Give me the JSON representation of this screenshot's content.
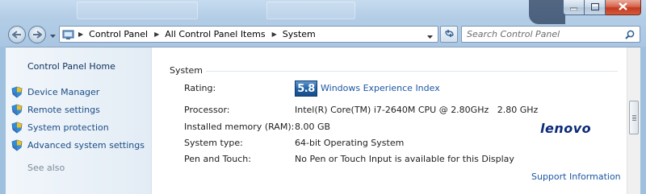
{
  "window": {
    "minimize_icon": "minimize-icon",
    "maximize_icon": "maximize-icon",
    "close_icon": "close-icon"
  },
  "navigation": {
    "back_icon": "back-arrow-icon",
    "forward_icon": "forward-arrow-icon",
    "breadcrumb": [
      "Control Panel",
      "All Control Panel Items",
      "System"
    ],
    "search_placeholder": "Search Control Panel"
  },
  "sidebar": {
    "home_label": "Control Panel Home",
    "tasks": [
      {
        "label": "Device Manager"
      },
      {
        "label": "Remote settings"
      },
      {
        "label": "System protection"
      },
      {
        "label": "Advanced system settings"
      }
    ],
    "see_also_label": "See also"
  },
  "system": {
    "section_title": "System",
    "rows": [
      {
        "label": "Rating:",
        "value": ""
      },
      {
        "label": "Processor:",
        "value": "Intel(R) Core(TM) i7-2640M CPU @ 2.80GHz   2.80 GHz"
      },
      {
        "label": "Installed memory (RAM):",
        "value": "8.00 GB"
      },
      {
        "label": "System type:",
        "value": "64-bit Operating System"
      },
      {
        "label": "Pen and Touch:",
        "value": "No Pen or Touch Input is available for this Display"
      }
    ],
    "rating_score": "5.8",
    "rating_link": "Windows Experience Index",
    "oem_logo": "lenovo",
    "support_link": "Support Information"
  },
  "colors": {
    "link": "#1a56a3",
    "badge": "#1f5fa3",
    "oem_logo": "#0b2a78"
  }
}
